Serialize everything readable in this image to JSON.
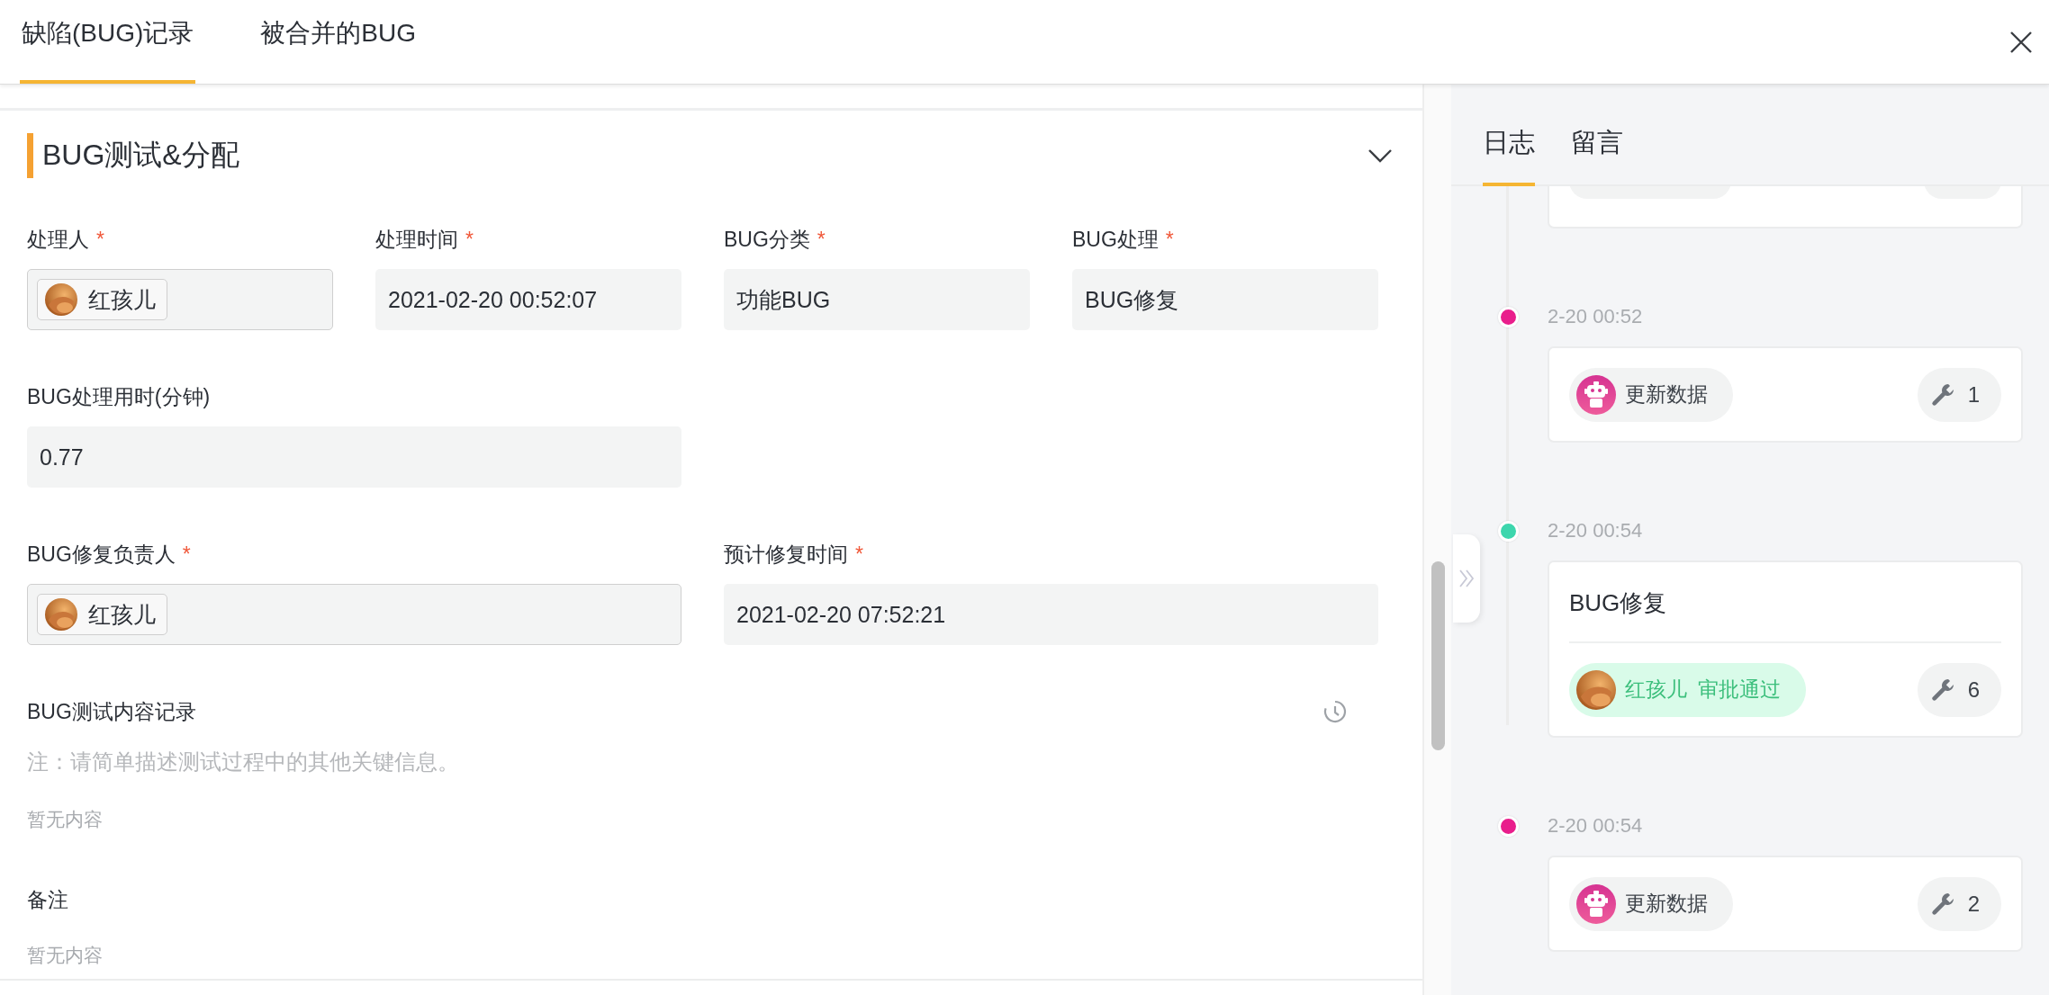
{
  "tabs": [
    {
      "label": "缺陷(BUG)记录",
      "selected": true
    },
    {
      "label": "被合并的BUG",
      "selected": false
    }
  ],
  "section": {
    "title": "BUG测试&分配",
    "expanded": true
  },
  "field_rows": [
    [
      {
        "label": "处理人",
        "required_mark": "*",
        "kind": "user",
        "value": "红孩儿"
      },
      {
        "label": "处理时间",
        "required_mark": "*",
        "kind": "text",
        "value": "2021-02-20 00:52:07"
      },
      {
        "label": "BUG分类",
        "required_mark": "*",
        "kind": "text",
        "value": "功能BUG"
      },
      {
        "label": "BUG处理",
        "required_mark": "*",
        "kind": "text",
        "value": "BUG修复"
      }
    ],
    [
      {
        "label": "BUG处理用时(分钟)",
        "kind": "text",
        "value": "0.77"
      }
    ],
    [
      {
        "label": "BUG修复负责人",
        "required_mark": "*",
        "kind": "user",
        "value": "红孩儿"
      },
      {
        "label": "预计修复时间",
        "required_mark": "*",
        "kind": "text",
        "value": "2021-02-20 07:52:21"
      }
    ]
  ],
  "notes": [
    {
      "kind": "record",
      "label": "BUG测试内容记录",
      "hint": "注：请简单描述测试过程中的其他关键信息。",
      "content": "暂无内容"
    },
    {
      "kind": "plain",
      "label": "备注",
      "content": "暂无内容"
    }
  ],
  "side_tabs": [
    {
      "label": "日志",
      "selected": true
    },
    {
      "label": "留言",
      "selected": false
    }
  ],
  "log": [
    {
      "kind": "clipped"
    },
    {
      "kind": "update",
      "time": "2-20 00:52",
      "color": "#e91e8c",
      "actor": "更新数据",
      "count": "1"
    },
    {
      "kind": "approval",
      "time": "2-20 00:54",
      "color": "#3dd6ad",
      "title": "BUG修复",
      "actor": "红孩儿",
      "action": "审批通过",
      "count": "6"
    },
    {
      "kind": "update",
      "time": "2-20 00:54",
      "color": "#e91e8c",
      "actor": "更新数据",
      "count": "2"
    }
  ]
}
